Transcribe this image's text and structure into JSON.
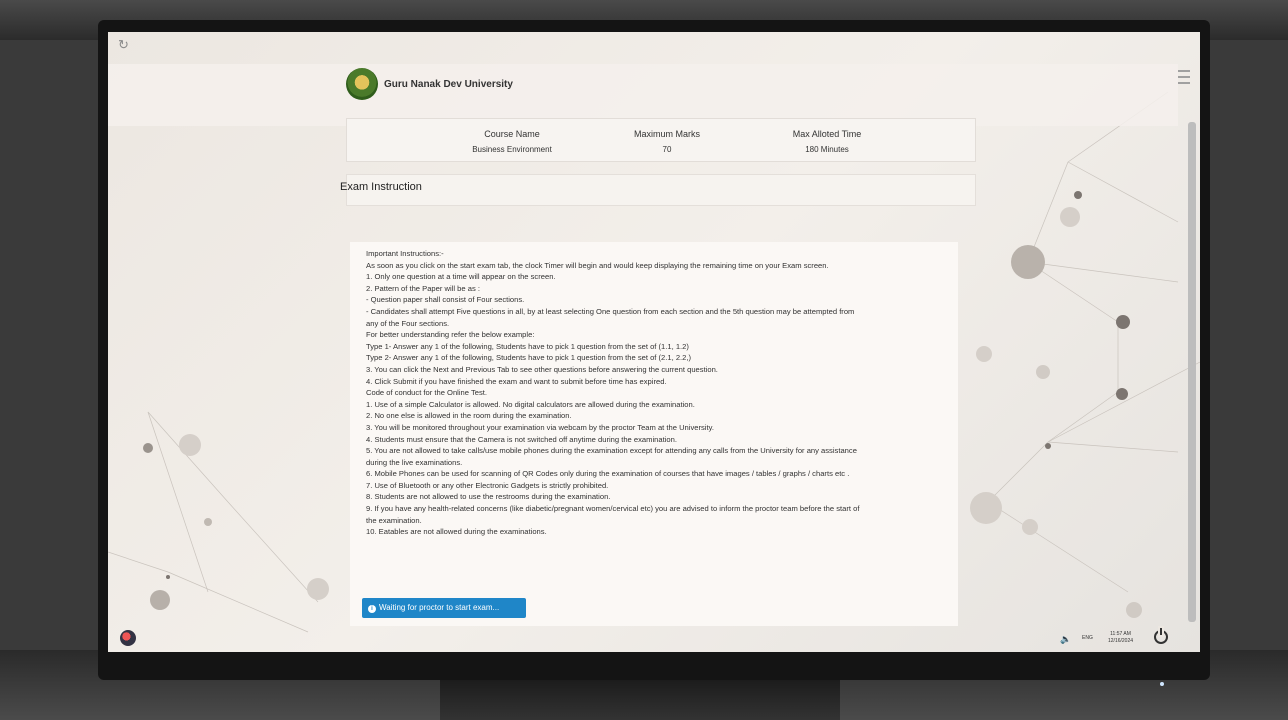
{
  "header": {
    "university_name": "Guru Nanak Dev University"
  },
  "course": {
    "name_label": "Course Name",
    "name_value": "Business Environment",
    "marks_label": "Maximum Marks",
    "marks_value": "70",
    "time_label": "Max Alloted Time",
    "time_value": "180 Minutes"
  },
  "exam_instruction_title": "Exam Instruction",
  "instructions": [
    "Important Instructions:-",
    "As soon as you click on the start exam tab, the clock Timer will begin and would keep displaying the remaining time on your Exam screen.",
    "1. Only one question at a time will appear on the screen.",
    "2. Pattern of the Paper will be as :",
    "- Question paper shall consist of Four sections.",
    "- Candidates shall attempt Five questions in all, by at least selecting One question from each section and the 5th question may be attempted from",
    "any of the Four sections.",
    "For better understanding refer the below example:",
    "Type 1- Answer any 1 of the following, Students have to pick 1 question from the set of (1.1, 1.2)",
    "Type 2- Answer any 1 of the following, Students have to pick 1 question from the set of (2.1, 2.2,)",
    "3. You can click the Next and Previous Tab to see other questions before answering the current question.",
    "4. Click Submit if you have finished the exam and want to submit before time has expired.",
    "Code of conduct for the Online Test.",
    "1. Use of a simple Calculator is allowed. No digital calculators are allowed during the examination.",
    "2. No one else is allowed in the room during the examination.",
    "3. You will be monitored throughout your examination via webcam by the proctor Team at the University.",
    "4. Students must ensure that the Camera is not switched off anytime during the examination.",
    "5. You are not allowed to take calls/use mobile phones during the examination except for attending any calls from the University for any assistance",
    "during the live examinations.",
    "6. Mobile Phones can be used for scanning of QR Codes only during the examination of courses that have images / tables / graphs / charts etc .",
    "7. Use of Bluetooth or any other Electronic Gadgets is strictly prohibited.",
    "8. Students are not allowed to use the restrooms during the examination.",
    "9. If you have any health-related concerns (like diabetic/pregnant women/cervical etc) you are advised to inform the proctor team before the start of",
    "the examination.",
    "10. Eatables are not allowed during the examinations."
  ],
  "wait_button": {
    "label": "Waiting for proctor to start exam..."
  },
  "taskbar": {
    "language": "ENG",
    "time": "11:57 AM",
    "date": "12/16/2024"
  },
  "colors": {
    "button_blue": "#1f86c8",
    "screen_bg": "#ece7e1"
  }
}
